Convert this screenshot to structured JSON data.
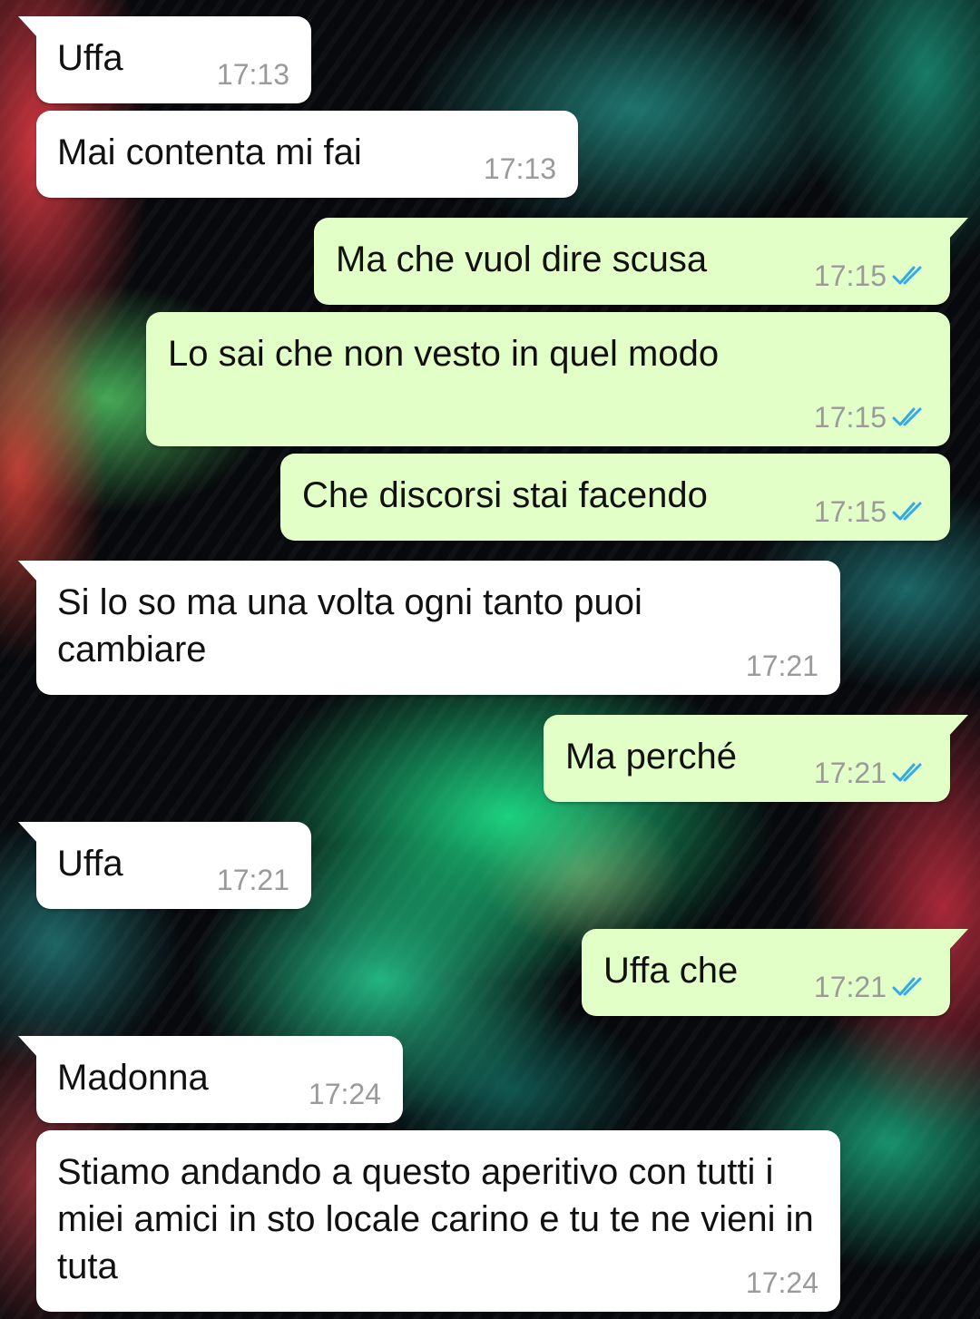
{
  "colors": {
    "incoming_bubble": "#ffffff",
    "outgoing_bubble": "#e2ffc7",
    "timestamp": "#9a9a9a",
    "read_ticks": "#34a9e6"
  },
  "messages": [
    {
      "direction": "incoming",
      "text": "Uffa",
      "time": "17:13"
    },
    {
      "direction": "incoming",
      "text": "Mai contenta mi fai",
      "time": "17:13"
    },
    {
      "direction": "outgoing",
      "text": "Ma che vuol dire scusa",
      "time": "17:15",
      "status_icon": "double-check-read-icon"
    },
    {
      "direction": "outgoing",
      "text": "Lo sai che non vesto in quel modo",
      "time": "17:15",
      "status_icon": "double-check-read-icon"
    },
    {
      "direction": "outgoing",
      "text": "Che discorsi stai facendo",
      "time": "17:15",
      "status_icon": "double-check-read-icon"
    },
    {
      "direction": "incoming",
      "text": "Si lo so ma una volta ogni tanto puoi cambiare",
      "time": "17:21"
    },
    {
      "direction": "outgoing",
      "text": "Ma perché",
      "time": "17:21",
      "status_icon": "double-check-read-icon"
    },
    {
      "direction": "incoming",
      "text": "Uffa",
      "time": "17:21"
    },
    {
      "direction": "outgoing",
      "text": "Uffa che",
      "time": "17:21",
      "status_icon": "double-check-read-icon"
    },
    {
      "direction": "incoming",
      "text": "Madonna",
      "time": "17:24"
    },
    {
      "direction": "incoming",
      "text": "Stiamo andando a questo aperitivo con tutti i miei amici in sto locale carino e tu te ne vieni in tuta",
      "time": "17:24"
    }
  ]
}
